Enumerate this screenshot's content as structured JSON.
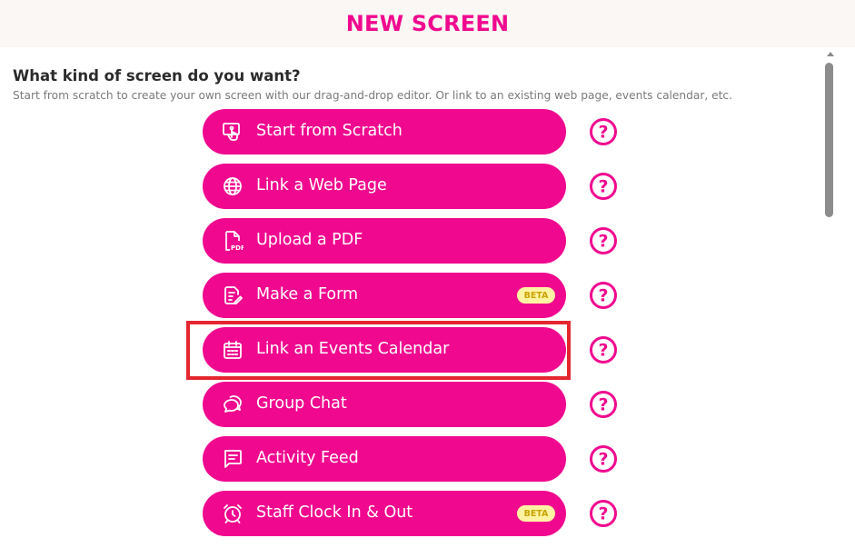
{
  "header": {
    "title": "NEW SCREEN"
  },
  "intro": {
    "question": "What kind of screen do you want?",
    "description": "Start from scratch to create your own screen with our drag-and-drop editor. Or link to an existing web page, events calendar, etc."
  },
  "options": [
    {
      "label": "Start from Scratch",
      "icon": "touch-screen-icon"
    },
    {
      "label": "Link a Web Page",
      "icon": "globe-icon"
    },
    {
      "label": "Upload a PDF",
      "icon": "pdf-file-icon"
    },
    {
      "label": "Make a Form",
      "icon": "form-edit-icon",
      "badge": "BETA"
    },
    {
      "label": "Link an Events Calendar",
      "icon": "calendar-icon"
    },
    {
      "label": "Group Chat",
      "icon": "chat-bubbles-icon"
    },
    {
      "label": "Activity Feed",
      "icon": "feed-message-icon"
    },
    {
      "label": "Staff Clock In & Out",
      "icon": "alarm-clock-icon",
      "badge": "BETA"
    }
  ],
  "help_icon": "question-circle-icon",
  "colors": {
    "brand_pink": "#f0098f",
    "highlight_red": "#e5262f",
    "beta_bg": "#fff3a3",
    "header_bg": "#faf7f4"
  }
}
